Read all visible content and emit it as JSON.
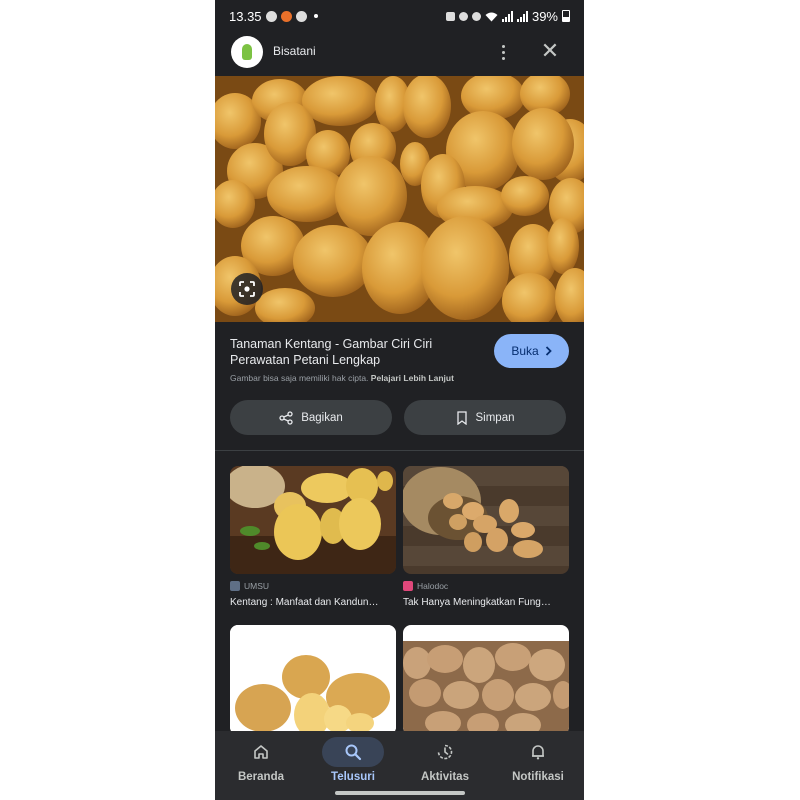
{
  "status_bar": {
    "time": "13.35",
    "battery": "39%"
  },
  "header": {
    "site_name": "Bisatani"
  },
  "result": {
    "title": "Tanaman Kentang - Gambar Ciri Ciri Perawatan Petani Lengkap",
    "open_button": "Buka",
    "copyright_note": "Gambar bisa saja memiliki hak cipta.",
    "learn_more": "Pelajari Lebih Lanjut",
    "share_label": "Bagikan",
    "save_label": "Simpan"
  },
  "related": [
    {
      "source": "UMSU",
      "caption": "Kentang : Manfaat dan Kandun…"
    },
    {
      "source": "Halodoc",
      "caption": "Tak Hanya Meningkatkan Fung…"
    }
  ],
  "bottom_nav": {
    "items": [
      {
        "label": "Beranda",
        "icon": "home-icon",
        "active": false
      },
      {
        "label": "Telusuri",
        "icon": "search-icon",
        "active": true
      },
      {
        "label": "Aktivitas",
        "icon": "history-icon",
        "active": false
      },
      {
        "label": "Notifikasi",
        "icon": "bell-icon",
        "active": false
      }
    ]
  },
  "colors": {
    "background": "#202124",
    "accent": "#8ab4f8",
    "pill": "#3c4043",
    "nav_active": "#394457"
  }
}
